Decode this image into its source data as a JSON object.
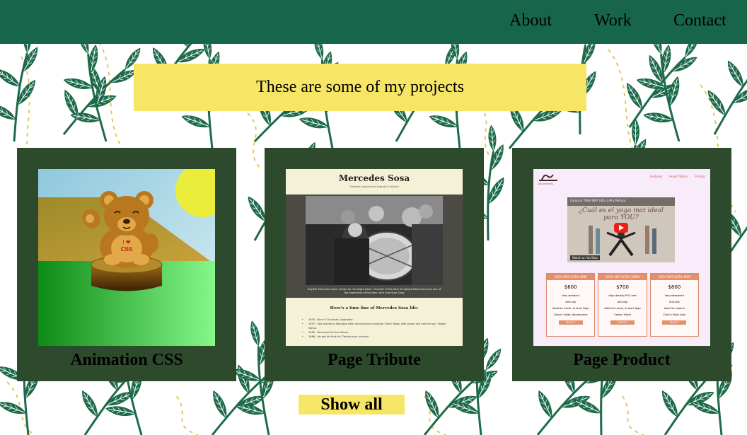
{
  "nav": {
    "items": [
      {
        "label": "About"
      },
      {
        "label": "Work"
      },
      {
        "label": "Contact"
      }
    ]
  },
  "banner": {
    "text": "These are some of my projects"
  },
  "projects": [
    {
      "title": "Animation CSS",
      "thumb": {
        "bear_text_top": "I ❤",
        "bear_text_bottom": "CSS"
      }
    },
    {
      "title": "Page Tribute",
      "thumb": {
        "heading": "Mercedes Sosa",
        "subheading": "Greatest exponent of Argentine folklore",
        "caption": "Haydée Mercedes Sosa, known as \"La Negra Sosa\". Founder of the New Songbook Movement and one of the exponents of the New Latin American Song",
        "timeline_title": "Here's a time line of Mercedes Sosa life:",
        "timeline": [
          "1935 - Born in Tucuman, Argentine",
          "1957 - She moved to Mendoza after marrying the musician Víctor Yosta, with whom she had her son, Fabián Matus.",
          "1965 - Recorded his first album",
          "1966 - He got his first hit: Zamba para no morir"
        ]
      }
    },
    {
      "title": "Page Product",
      "thumb": {
        "brand": "ALTA POSTURA",
        "nav": [
          "Features",
          "How It Works",
          "Pricing"
        ],
        "video_title": "Comprar YOGA MAT Ultra | Alta Postura",
        "video_overlay": "¿Cuál es el yoga mat ideal para YOU?",
        "watch_on": "Watch on",
        "youtube": "YouTube",
        "plans": [
          {
            "name": "YOGA MAT ULTRA 4MM",
            "price": "$600",
            "features": [
              "Very resistant",
              "Anti-slip",
              "Ideal for travel, to start Yoga",
              "Colors: Violet, Aquamarine"
            ],
            "button": "SELECT"
          },
          {
            "name": "YOGA MAT ULTRA 10MM",
            "price": "$700",
            "features": [
              "High-density PVC mat",
              "Anti-slip",
              "Ideal for travel, to start Yoga",
              "Colors: Violet"
            ],
            "button": "SELECT"
          },
          {
            "name": "YOGA MAT ULTRA 6MM",
            "price": "$800",
            "features": [
              "Very absorbent",
              "Anti-slip",
              "Ideal for experts",
              "Colors: Navy blue"
            ],
            "button": "SELECT"
          }
        ]
      }
    }
  ],
  "show_all": {
    "label": "Show all"
  },
  "colors": {
    "navbar": "#17654a",
    "banner": "#f7e566",
    "card": "#2d4a2c",
    "leaf": "#1d6b4a",
    "dash": "#e6c65a"
  }
}
